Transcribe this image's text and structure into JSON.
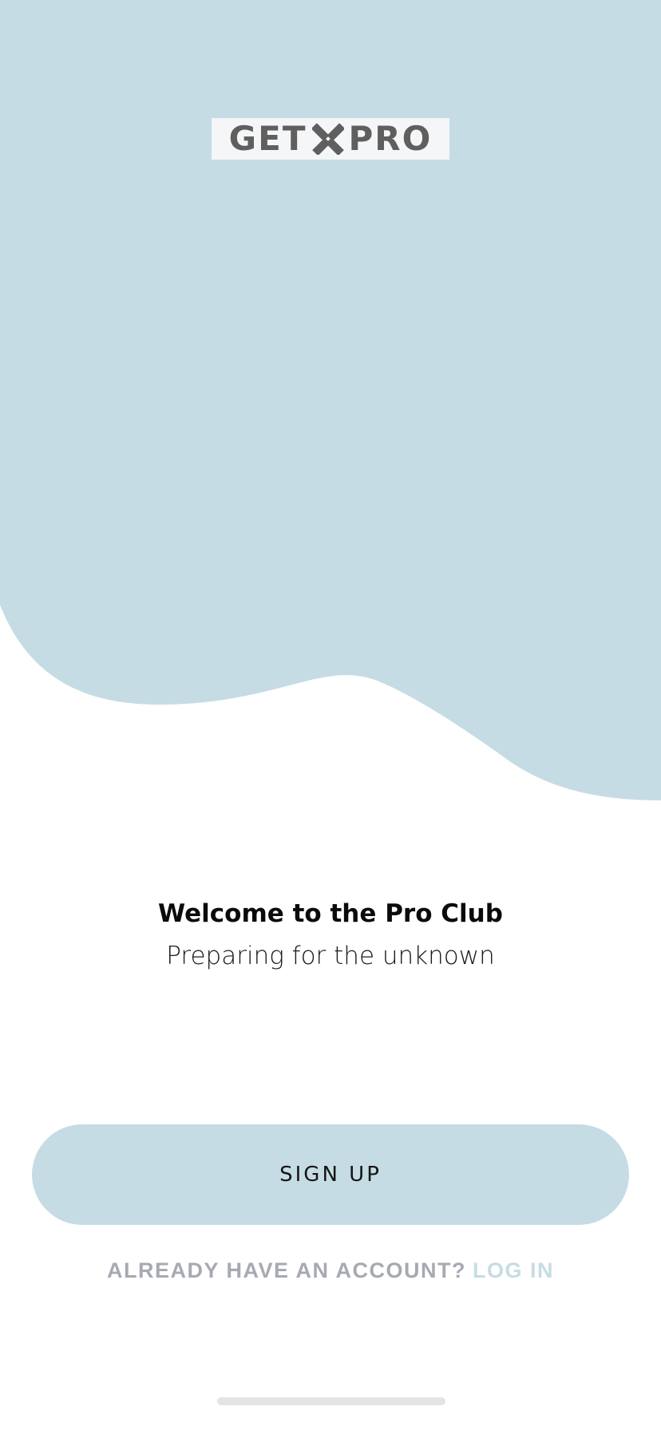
{
  "colors": {
    "wave": "#c6dce4",
    "logo_text": "#5f5f5f",
    "button_bg": "#c6dce4",
    "muted_text": "#a7a9b3",
    "link_text": "#c6dce4"
  },
  "logo": {
    "left_text": "GET",
    "mark_icon": "x-cross-icon",
    "right_text": "PRO"
  },
  "welcome": {
    "title": "Welcome to the Pro Club",
    "subtitle": "Preparing for the unknown"
  },
  "signup": {
    "label": "SIGN UP"
  },
  "account": {
    "prompt": "ALREADY HAVE AN ACCOUNT?",
    "login_label": "LOG IN"
  }
}
